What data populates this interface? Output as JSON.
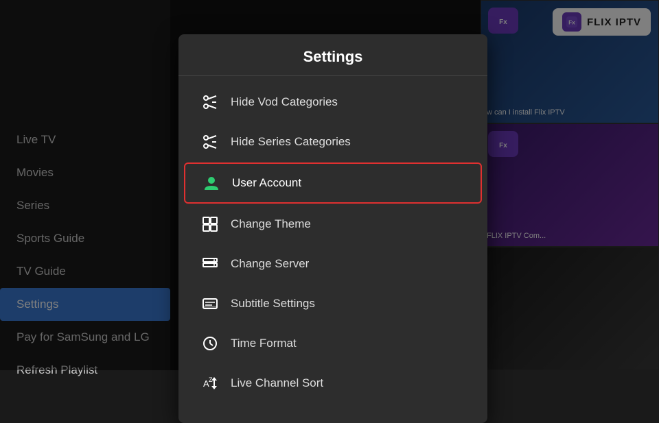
{
  "logo": {
    "text": "FLIX IPTV"
  },
  "sidebar": {
    "items": [
      {
        "id": "live-tv",
        "label": "Live TV",
        "active": false
      },
      {
        "id": "movies",
        "label": "Movies",
        "active": false
      },
      {
        "id": "series",
        "label": "Series",
        "active": false
      },
      {
        "id": "sports-guide",
        "label": "Sports Guide",
        "active": false
      },
      {
        "id": "tv-guide",
        "label": "TV Guide",
        "active": false
      },
      {
        "id": "settings",
        "label": "Settings",
        "active": true
      },
      {
        "id": "pay-samsung-lg",
        "label": "Pay for SamSung and LG",
        "active": false
      },
      {
        "id": "refresh-playlist",
        "label": "Refresh Playlist",
        "active": false
      }
    ]
  },
  "settings": {
    "title": "Settings",
    "items": [
      {
        "id": "hide-vod",
        "label": "Hide Vod Categories",
        "icon": "scissors"
      },
      {
        "id": "hide-series",
        "label": "Hide Series Categories",
        "icon": "scissors2"
      },
      {
        "id": "user-account",
        "label": "User Account",
        "icon": "user",
        "selected": true
      },
      {
        "id": "change-theme",
        "label": "Change Theme",
        "icon": "theme"
      },
      {
        "id": "change-server",
        "label": "Change Server",
        "icon": "server"
      },
      {
        "id": "subtitle-settings",
        "label": "Subtitle Settings",
        "icon": "subtitle"
      },
      {
        "id": "time-format",
        "label": "Time Format",
        "icon": "clock"
      },
      {
        "id": "live-channel-sort",
        "label": "Live Channel Sort",
        "icon": "sort"
      }
    ]
  },
  "right_thumbs": [
    {
      "text": "w can I install Flix IPTV"
    },
    {
      "text": "FLIX IPTV Com..."
    },
    {
      "text": ""
    }
  ]
}
